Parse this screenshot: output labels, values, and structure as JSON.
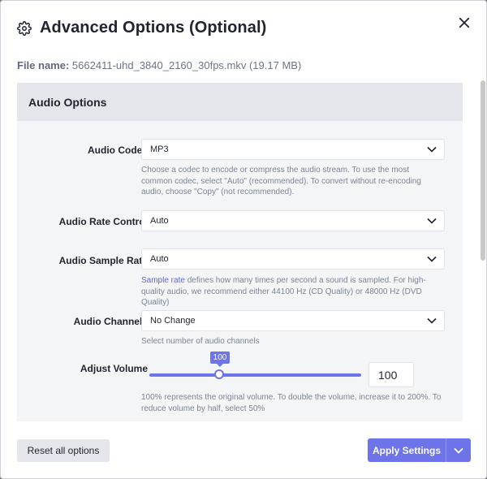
{
  "dialog": {
    "title": "Advanced Options (Optional)",
    "file_label": "File name:",
    "file_name": "5662411-uhd_3840_2160_30fps.mkv (19.17 MB)"
  },
  "audio": {
    "section_title": "Audio Options",
    "codec": {
      "label": "Audio Codec",
      "value": "MP3",
      "help": "Choose a codec to encode or compress the audio stream. To use the most common codec, select \"Auto\" (recommended). To convert without re-encoding audio, choose \"Copy\" (not recommended)."
    },
    "rate_control": {
      "label": "Audio Rate Control",
      "value": "Auto"
    },
    "sample_rate": {
      "label": "Audio Sample Rate",
      "value": "Auto",
      "help_link": "Sample rate",
      "help": " defines how many times per second a sound is sampled. For high-quality audio, we recommend either 44100 Hz (CD Quality) or 48000 Hz (DVD Quality)"
    },
    "channels": {
      "label": "Audio Channels",
      "value": "No Change",
      "help": "Select number of audio channels"
    },
    "volume": {
      "label": "Adjust Volume",
      "value": "100",
      "tooltip": "100",
      "help": "100% represents the original volume. To double the volume, increase it to 200%. To reduce volume by half, select 50%"
    }
  },
  "footer": {
    "reset_label": "Reset all options",
    "apply_label": "Apply Settings"
  },
  "colors": {
    "accent": "#6d73e8",
    "panel": "#f4f5f7",
    "header_band": "#e4e6ec"
  }
}
